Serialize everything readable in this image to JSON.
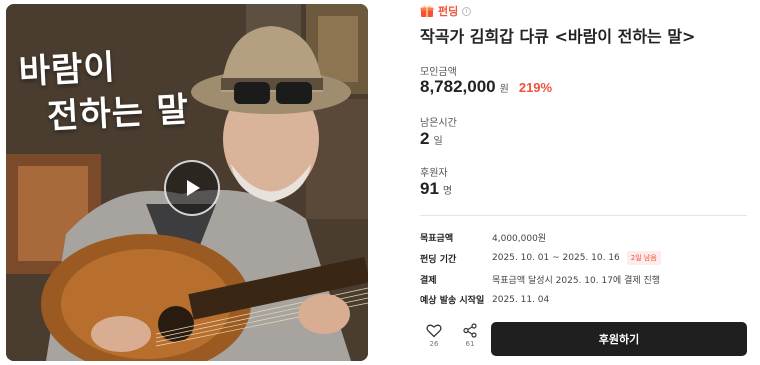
{
  "media": {
    "headline_line1": "바람이",
    "headline_line2": "전하는 말"
  },
  "badge": {
    "label": "펀딩"
  },
  "title": "작곡가 김희갑 다큐 <바람이 전하는 말>",
  "stats": {
    "amount": {
      "label": "모인금액",
      "value": "8,782,000",
      "unit": "원",
      "percent": "219%"
    },
    "time_left": {
      "label": "남은시간",
      "value": "2",
      "unit": "일"
    },
    "backers": {
      "label": "후원자",
      "value": "91",
      "unit": "명"
    }
  },
  "details": [
    {
      "key": "목표금액",
      "value": "4,000,000원"
    },
    {
      "key": "펀딩 기간",
      "value": "2025. 10. 01 ~ 2025. 10. 16",
      "tag": "2일 남음"
    },
    {
      "key": "결제",
      "value": "목표금액 달성시 2025. 10. 17에 결제 진행"
    },
    {
      "key": "예상 발송 시작일",
      "value": "2025. 11. 04"
    }
  ],
  "actions": {
    "like_count": "26",
    "share_count": "61",
    "support_label": "후원하기"
  },
  "colors": {
    "accent": "#f0533a",
    "button": "#1f1f1f"
  },
  "icons": [
    "gift-icon",
    "info-icon",
    "play-icon",
    "heart-icon",
    "share-icon"
  ]
}
